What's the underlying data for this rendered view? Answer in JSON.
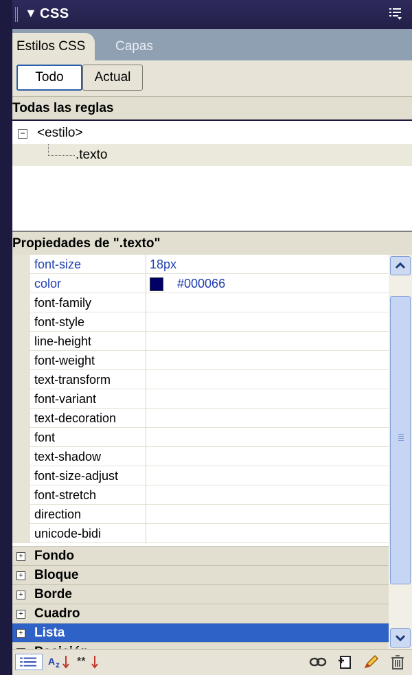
{
  "panel": {
    "title": "CSS"
  },
  "tabs": [
    {
      "label": "Estilos CSS"
    },
    {
      "label": "Capas"
    }
  ],
  "mode_toggle": {
    "all_label": "Todo",
    "current_label": "Actual"
  },
  "rules": {
    "header": "Todas las reglas",
    "items": [
      {
        "label": "<estilo>"
      },
      {
        "label": ".texto"
      }
    ]
  },
  "properties": {
    "header": "Propiedades de \".texto\"",
    "rows": [
      {
        "name": "font-size",
        "value": "18px"
      },
      {
        "name": "color",
        "value": "#000066"
      },
      {
        "name": "font-family",
        "value": ""
      },
      {
        "name": "font-style",
        "value": ""
      },
      {
        "name": "line-height",
        "value": ""
      },
      {
        "name": "font-weight",
        "value": ""
      },
      {
        "name": "text-transform",
        "value": ""
      },
      {
        "name": "font-variant",
        "value": ""
      },
      {
        "name": "text-decoration",
        "value": ""
      },
      {
        "name": "font",
        "value": ""
      },
      {
        "name": "text-shadow",
        "value": ""
      },
      {
        "name": "font-size-adjust",
        "value": ""
      },
      {
        "name": "font-stretch",
        "value": ""
      },
      {
        "name": "direction",
        "value": ""
      },
      {
        "name": "unicode-bidi",
        "value": ""
      }
    ],
    "categories": [
      {
        "label": "Fondo"
      },
      {
        "label": "Bloque"
      },
      {
        "label": "Borde"
      },
      {
        "label": "Cuadro"
      },
      {
        "label": "Lista"
      },
      {
        "label": "Posición"
      }
    ]
  },
  "colors": {
    "set_property": "#1f3fb0",
    "selection": "#2f62c7",
    "swatch": "#000066"
  }
}
